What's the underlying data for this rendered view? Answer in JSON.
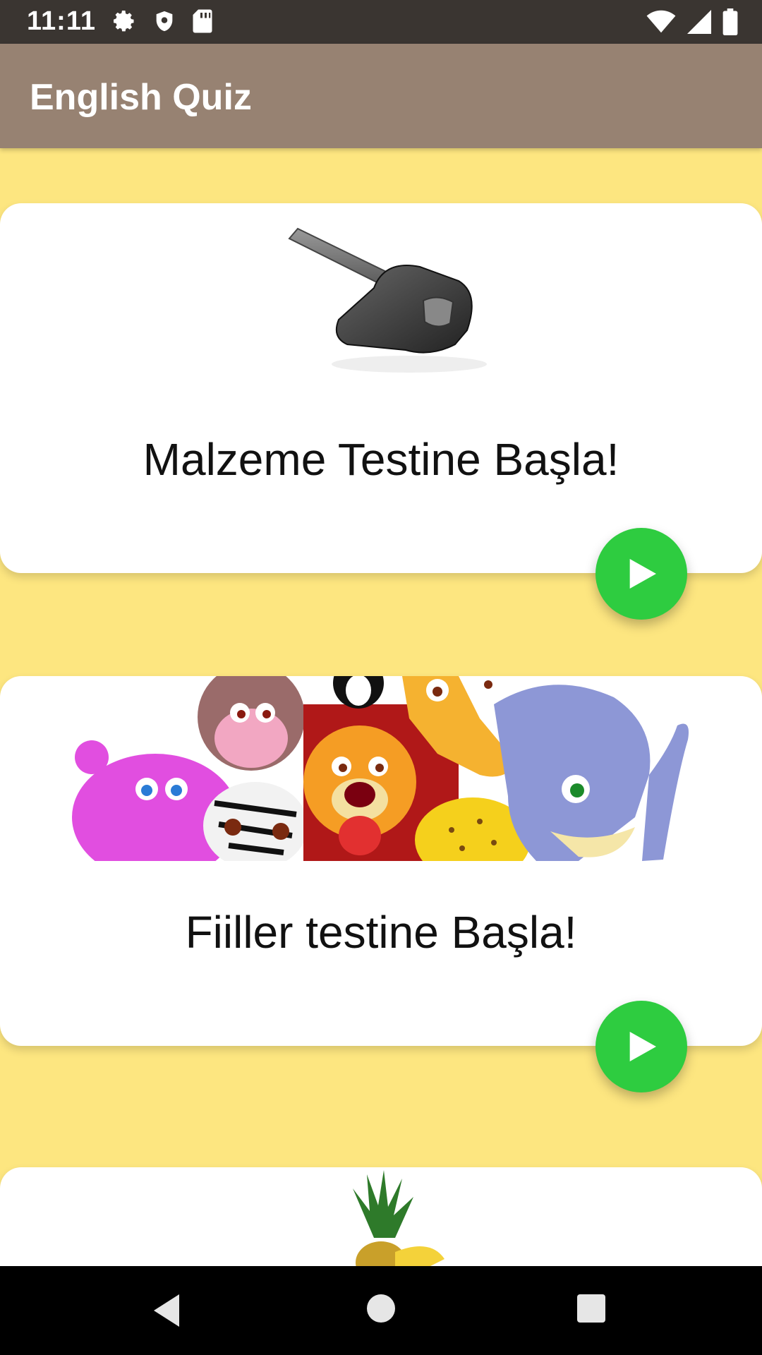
{
  "status_bar": {
    "time": "11:11",
    "icons_left": [
      "gear-icon",
      "shield-icon",
      "sd-card-icon"
    ],
    "icons_right": [
      "wifi-icon",
      "signal-icon",
      "battery-icon"
    ]
  },
  "app_bar": {
    "title": "English Quiz"
  },
  "cards": [
    {
      "image": "sledgehammer-image",
      "label": "Malzeme Testine Başla!",
      "button_icon": "play-icon"
    },
    {
      "image": "cartoon-animals-image",
      "label": "Fiiller testine Başla!",
      "button_icon": "play-icon"
    },
    {
      "image": "fruits-image",
      "label": ""
    }
  ],
  "colors": {
    "background": "#fde680",
    "app_bar": "#978272",
    "status_bar": "#3a3531",
    "play_button": "#2ecc40",
    "card": "#ffffff"
  },
  "nav_bar": {
    "buttons": [
      "back-icon",
      "home-icon",
      "recents-icon"
    ]
  }
}
